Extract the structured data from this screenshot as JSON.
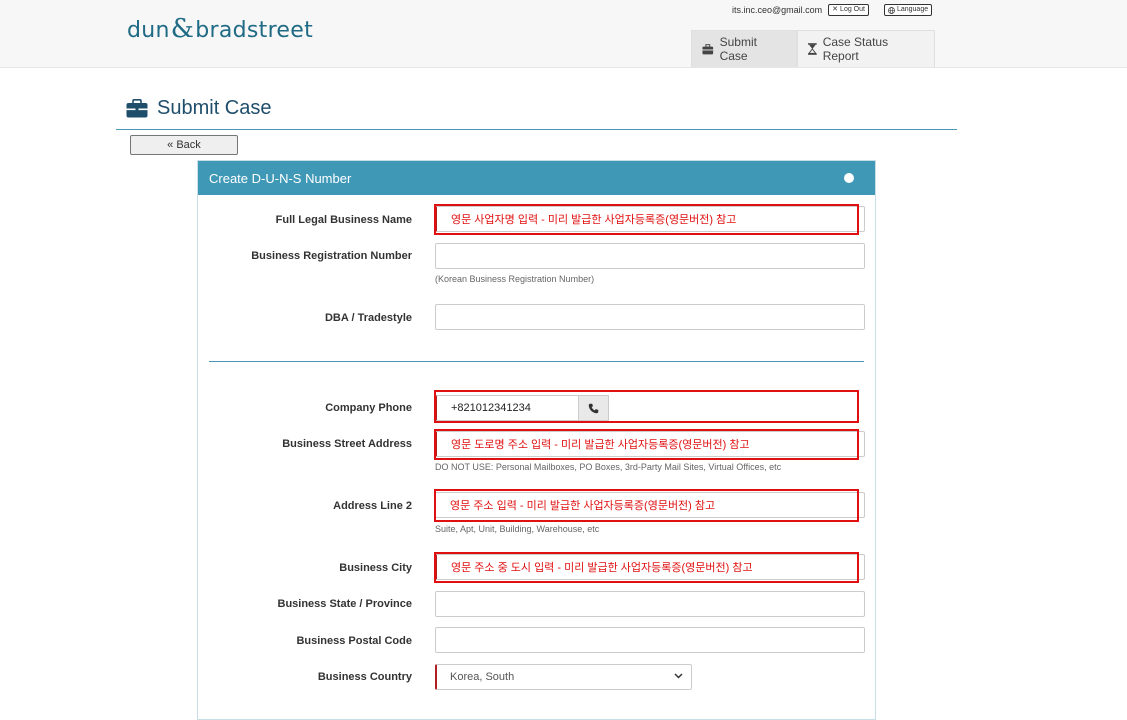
{
  "header": {
    "logo_left": "dun",
    "logo_amp": "&",
    "logo_right": "bradstreet",
    "account_email": "its.inc.ceo@gmail.com",
    "logout_label": "Log Out",
    "language_label": "Language",
    "tabs": [
      {
        "label": "Submit Case",
        "icon": "briefcase-icon",
        "active": true
      },
      {
        "label": "Case Status Report",
        "icon": "hourglass-icon",
        "active": false
      }
    ]
  },
  "page": {
    "title": "Submit Case",
    "back_label": "« Back"
  },
  "form": {
    "panel_title": "Create D-U-N-S Number",
    "fields": {
      "legal_name": {
        "label": "Full Legal Business Name",
        "value": "영문 사업자명 입력 - 미리 발급한 사업자등록증(영문버전) 참고"
      },
      "reg_number": {
        "label": "Business Registration Number",
        "value": "",
        "help": "(Korean Business Registration Number)"
      },
      "dba": {
        "label": "DBA / Tradestyle",
        "value": ""
      },
      "phone": {
        "label": "Company Phone",
        "value": "+821012341234"
      },
      "street": {
        "label": "Business Street Address",
        "value": "영문 도로명 주소 입력 - 미리 발급한 사업자등록증(영문버전) 참고",
        "help": "DO NOT USE: Personal Mailboxes, PO Boxes, 3rd-Party Mail Sites, Virtual Offices, etc"
      },
      "address2": {
        "label": "Address Line 2",
        "value": "영문 주소 입력 - 미리 발급한 사업자등록증(영문버전) 참고",
        "help": "Suite, Apt, Unit, Building, Warehouse, etc"
      },
      "city": {
        "label": "Business City",
        "value": "영문 주소 중 도시 입력 - 미리 발급한 사업자등록증(영문버전) 참고"
      },
      "state": {
        "label": "Business State / Province",
        "value": ""
      },
      "postal": {
        "label": "Business Postal Code",
        "value": ""
      },
      "country": {
        "label": "Business Country",
        "value": "Korea, South"
      }
    }
  },
  "colors": {
    "accent": "#4098b7",
    "annotation_red": "#e01010",
    "brand": "#1f6a84"
  }
}
